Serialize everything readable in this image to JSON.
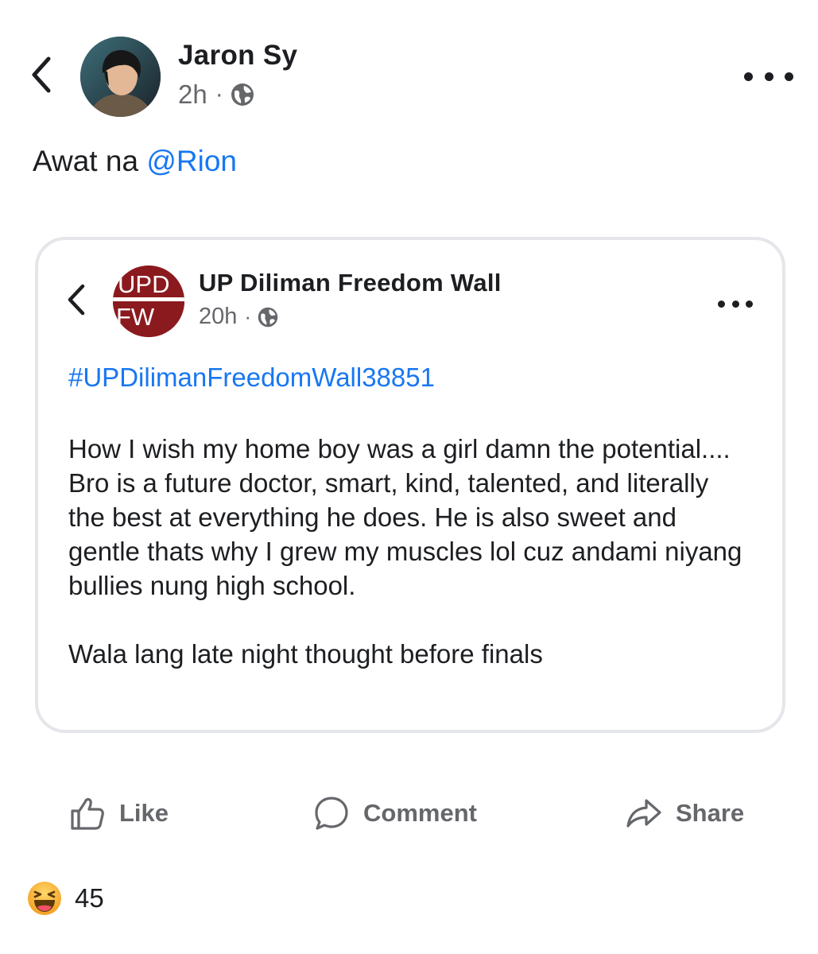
{
  "post": {
    "author_name": "Jaron Sy",
    "time": "2h",
    "separator": "·",
    "audience_icon": "globe-icon",
    "text_prefix": "Awat na ",
    "mention": "@Rion"
  },
  "shared_post": {
    "page_name": "UP Diliman Freedom Wall",
    "logo_text_top": "UPD",
    "logo_text_bottom": "FW",
    "time": "20h",
    "separator": "·",
    "hashtag": "#UPDilimanFreedomWall38851",
    "paragraph1": "How I wish my home boy was a girl damn the potential.... Bro is a future doctor, smart, kind, talented, and literally the best at everything he does. He is also sweet and gentle thats why I grew my muscles lol cuz andami niyang bullies nung high school.",
    "paragraph2": "Wala lang late night thought before finals"
  },
  "actions": {
    "like_label": "Like",
    "comment_label": "Comment",
    "share_label": "Share"
  },
  "reactions": {
    "icon": "laughing-face-icon",
    "count": "45"
  },
  "colors": {
    "link": "#1877f2",
    "secondary_text": "#65676b",
    "logo_red": "#8b1a1f",
    "reaction_orange": "#f7b125"
  }
}
